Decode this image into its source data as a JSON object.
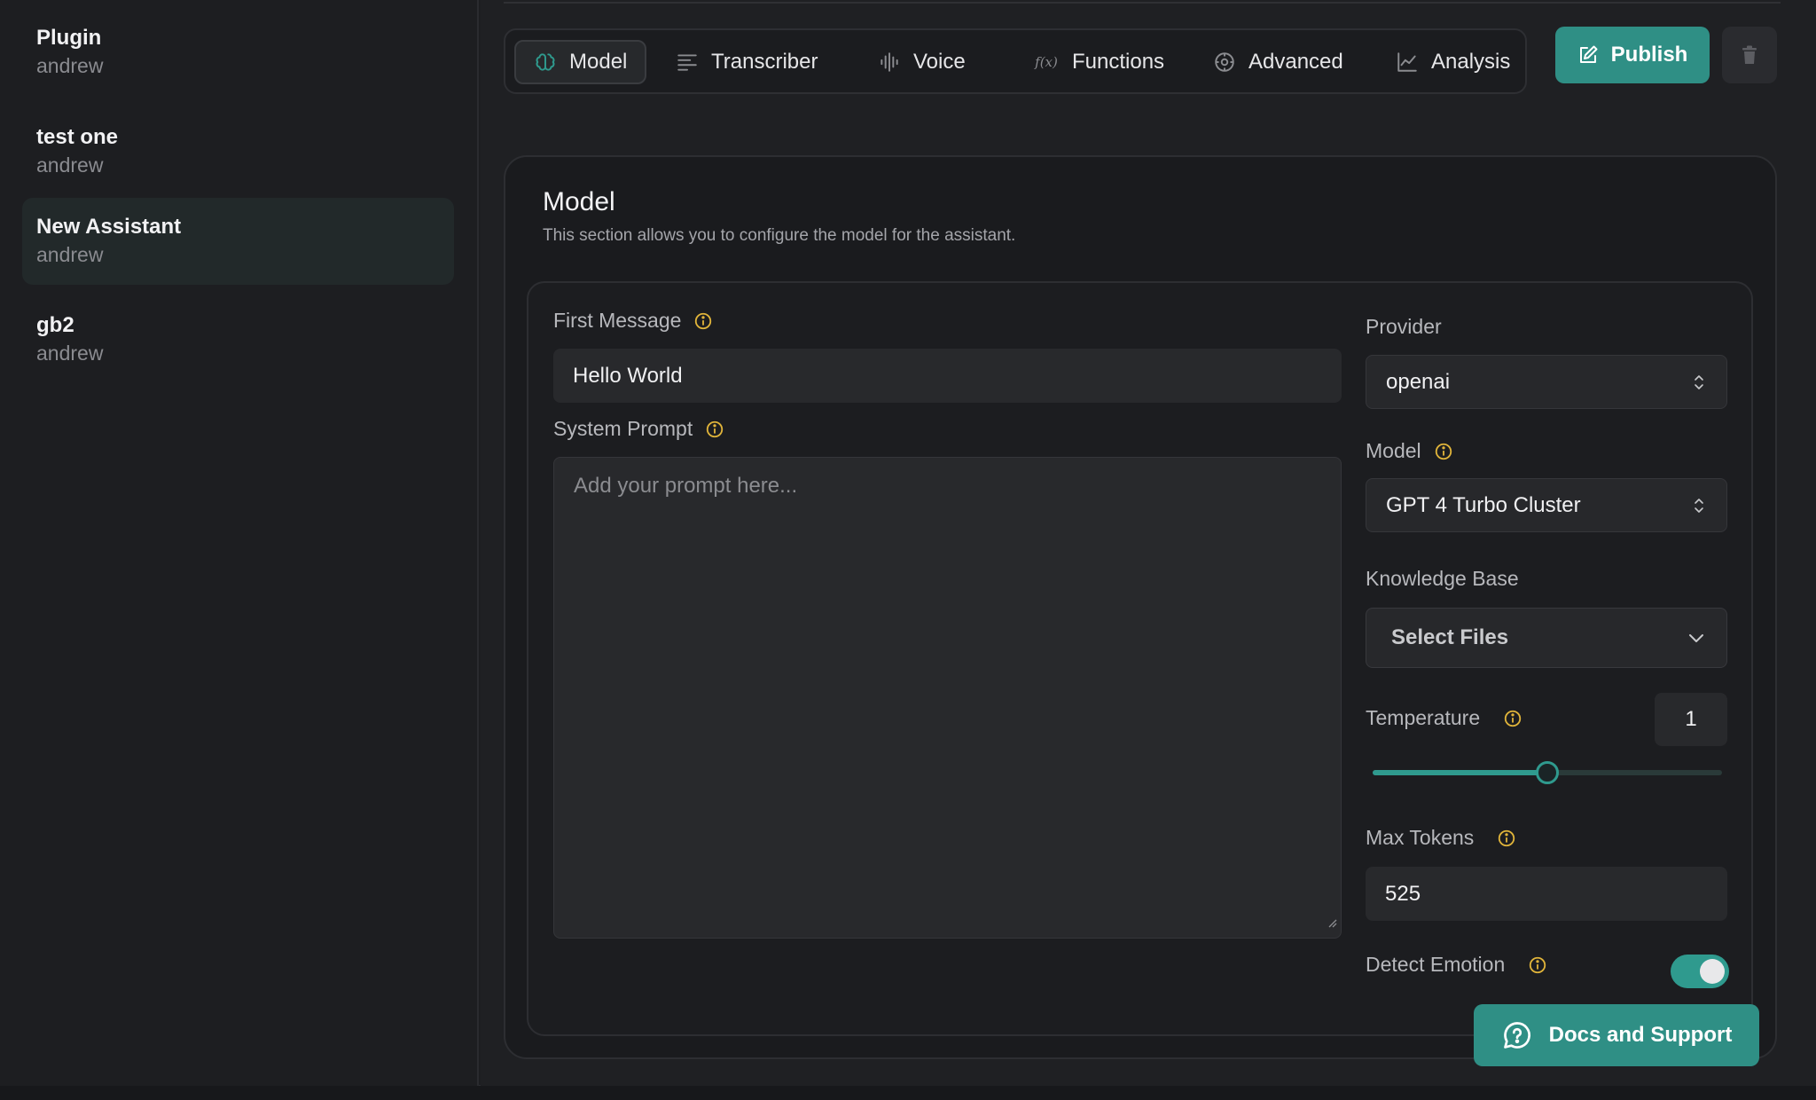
{
  "sidebar": {
    "assistants": [
      {
        "name": "Plugin",
        "owner": "andrew"
      },
      {
        "name": "test one",
        "owner": "andrew"
      },
      {
        "name": "New Assistant",
        "owner": "andrew"
      },
      {
        "name": "gb2",
        "owner": "andrew"
      }
    ]
  },
  "tabs": [
    {
      "label": "Model",
      "icon": "brain-icon"
    },
    {
      "label": "Transcriber",
      "icon": "lines-icon"
    },
    {
      "label": "Voice",
      "icon": "waveform-icon"
    },
    {
      "label": "Functions",
      "icon": "function-icon"
    },
    {
      "label": "Advanced",
      "icon": "settings-icon"
    },
    {
      "label": "Analysis",
      "icon": "chart-icon"
    }
  ],
  "toolbar": {
    "publish_label": "Publish"
  },
  "card": {
    "title": "Model",
    "description": "This section allows you to configure the model for the assistant."
  },
  "form": {
    "first_message_label": "First Message",
    "first_message_value": "Hello World",
    "system_prompt_label": "System Prompt",
    "system_prompt_placeholder": "Add your prompt here...",
    "provider_label": "Provider",
    "provider_value": "openai",
    "model_label": "Model",
    "model_value": "GPT 4 Turbo Cluster",
    "knowledge_base_label": "Knowledge Base",
    "knowledge_base_value": "Select Files",
    "temperature_label": "Temperature",
    "temperature_value": "1",
    "temperature_fraction": 0.5,
    "max_tokens_label": "Max Tokens",
    "max_tokens_value": "525",
    "detect_emotion_label": "Detect Emotion",
    "detect_emotion_on": true
  },
  "docs": {
    "label": "Docs and Support"
  },
  "colors": {
    "accent": "#2f8f85",
    "info": "#e0b43a"
  }
}
